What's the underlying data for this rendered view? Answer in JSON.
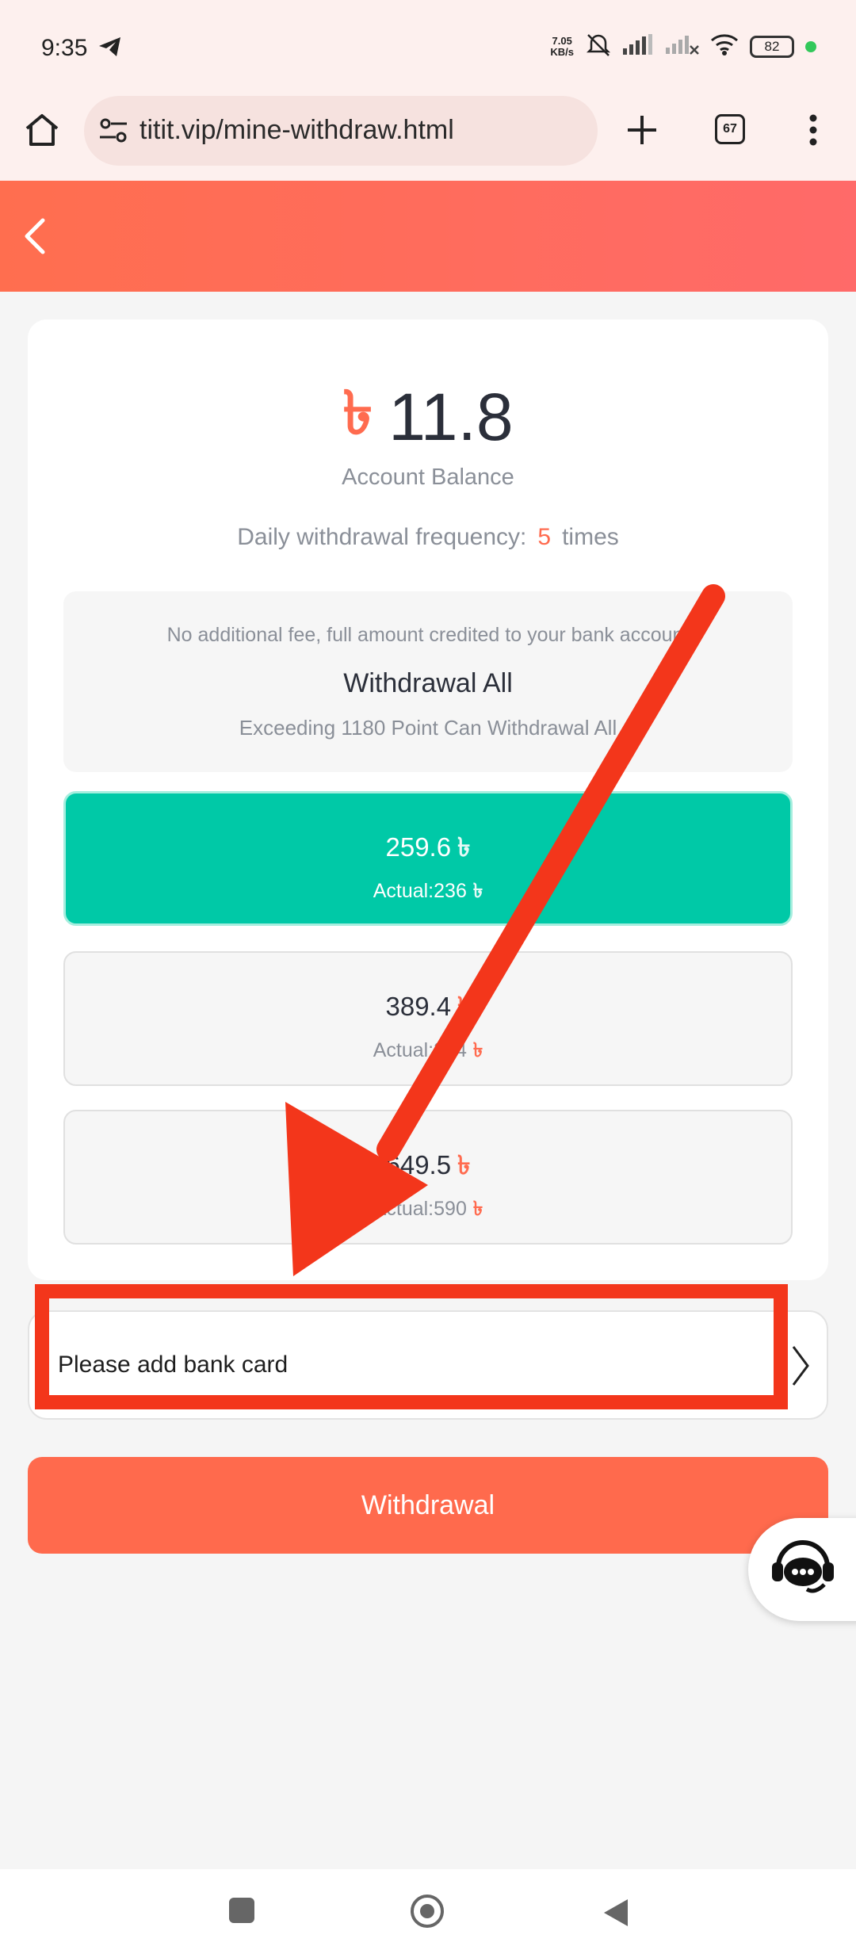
{
  "status_bar": {
    "time": "9:35",
    "net_speed": "7.05",
    "net_unit": "KB/s",
    "battery": "82"
  },
  "browser": {
    "url": "titit.vip/mine-withdraw.html",
    "tab_count": "67"
  },
  "balance": {
    "currency_symbol": "৳",
    "amount": "11.8",
    "label": "Account Balance",
    "frequency_label": "Daily withdrawal frequency:",
    "frequency_value": "5",
    "frequency_unit": "times"
  },
  "withdraw_all": {
    "note": "No additional fee, full amount credited to your bank account",
    "title": "Withdrawal All",
    "subtitle": "Exceeding 1180 Point Can Withdrawal All"
  },
  "options": [
    {
      "amount": "259.6",
      "actual": "Actual:236",
      "selected": true
    },
    {
      "amount": "389.4",
      "actual": "Actual:354",
      "selected": false
    },
    {
      "amount": "649.5",
      "actual": "Actual:590",
      "selected": false
    }
  ],
  "bank": {
    "label": "Please add bank card"
  },
  "withdraw_button": "Withdrawal",
  "colors": {
    "header": "#ff6e4f",
    "accent": "#ff6b4f",
    "selected_option": "#00c9a7",
    "annotation_red": "#f3361b"
  }
}
